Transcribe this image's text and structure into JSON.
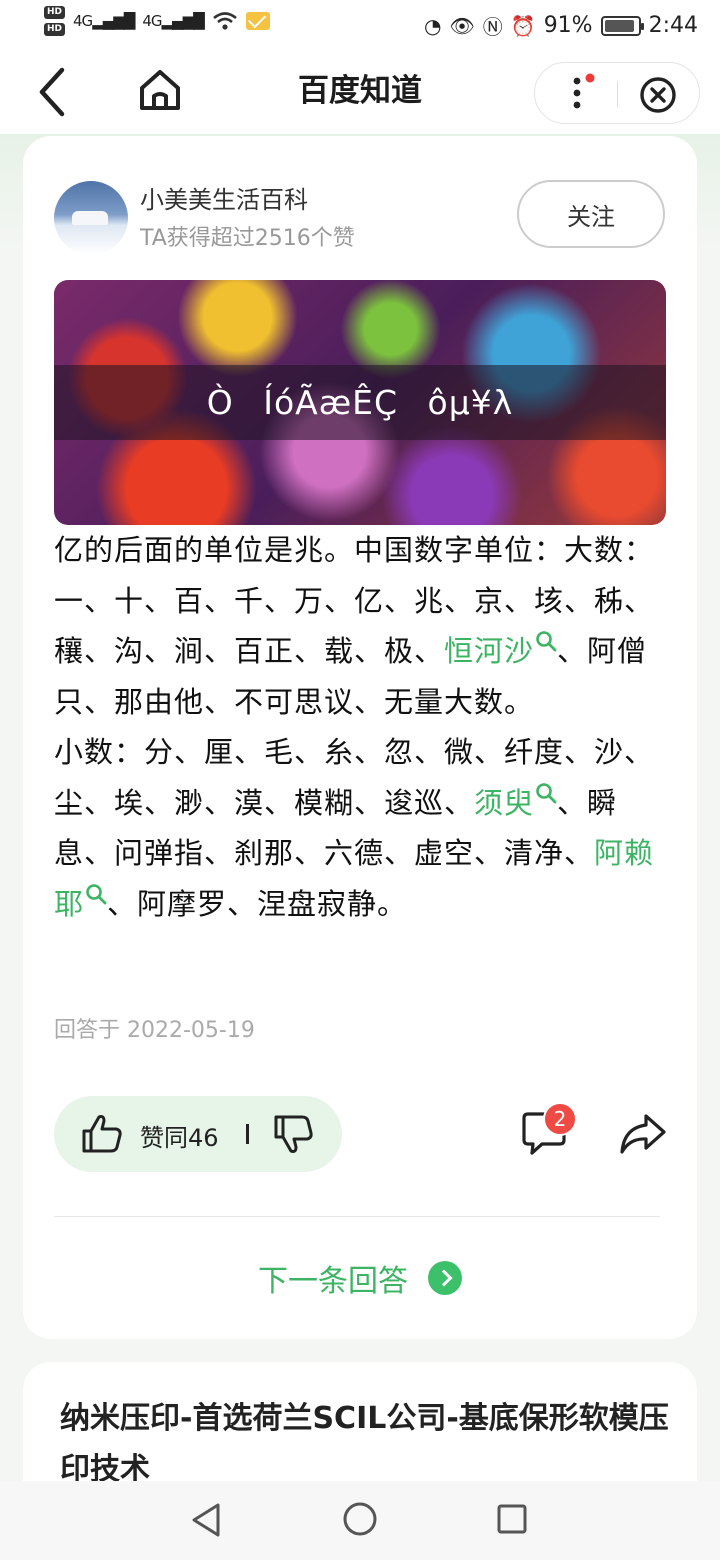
{
  "status_bar": {
    "network_label": "4G",
    "battery_percent": "91%",
    "time": "2:44",
    "battery_level": 0.91
  },
  "header": {
    "title": "百度知道"
  },
  "answer": {
    "author_name": "小美美生活百科",
    "author_likes": "TA获得超过2516个赞",
    "follow_label": "关注",
    "banner_text": "Ò  ÍóÃæÊÇ  ôµ¥λ",
    "segments": {
      "s1": "亿的后面的单位是兆。中国数字单位：大数：一、十、百、千、万、亿、兆、京、垓、秭、穰、沟、涧、百正、载、极、",
      "k1": "恒河沙",
      "s2": "、阿僧只、那由他、不可思议、无量大数。",
      "s3": "小数：分、厘、毛、糸、忽、微、纤度、沙、尘、埃、渺、漠、模糊、逡巡、",
      "k2": "须臾",
      "s4": "、瞬息、问弹指、刹那、六德、虚空、清净、",
      "k3": "阿赖耶",
      "s5": "、阿摩罗、涅盘寂静。"
    },
    "answered_date": "回答于 2022-05-19",
    "vote_label": "赞同46",
    "comment_count": "2",
    "next_answer_label": "下一条回答"
  },
  "ad": {
    "title": "纳米压印-首选荷兰SCIL公司-基底保形软模压印技术"
  },
  "colors": {
    "accent_green": "#3cb464",
    "badge_red": "#f04a45"
  },
  "icons": [
    "back-arrow-icon",
    "home-icon",
    "more-icon",
    "close-icon",
    "search-icon",
    "thumbs-up-icon",
    "thumbs-down-icon",
    "comment-icon",
    "share-icon",
    "chevron-right-icon"
  ]
}
